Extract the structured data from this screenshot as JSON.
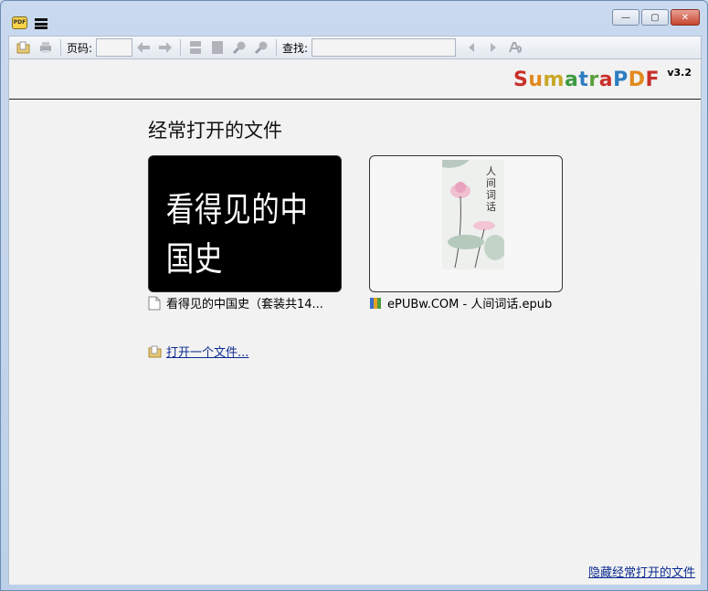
{
  "window": {
    "app_icon_text": "PDF",
    "buttons": {
      "minimize": "—",
      "maximize": "▢",
      "close": "✕"
    }
  },
  "toolbar": {
    "page_label": "页码:",
    "page_value": "",
    "find_label": "查找:",
    "find_value": ""
  },
  "brand": {
    "logo_letters": [
      {
        "ch": "S",
        "color": "#c8312b"
      },
      {
        "ch": "u",
        "color": "#e28a1e"
      },
      {
        "ch": "m",
        "color": "#c9a826"
      },
      {
        "ch": "a",
        "color": "#3d9a3f"
      },
      {
        "ch": "t",
        "color": "#2d7dc0"
      },
      {
        "ch": "r",
        "color": "#5a9e3a"
      },
      {
        "ch": "a",
        "color": "#c8312b"
      },
      {
        "ch": "P",
        "color": "#2d7dc0"
      },
      {
        "ch": "D",
        "color": "#e28a1e"
      },
      {
        "ch": "F",
        "color": "#c8312b"
      }
    ],
    "version": "v3.2"
  },
  "home": {
    "section_title": "经常打开的文件",
    "recent_files": [
      {
        "cover_text": "看得见的中国史",
        "label": "看得见的中国史（套装共14..."
      },
      {
        "cover_title": "人间词话",
        "label": "ePUBw.COM - 人间词话.epub"
      }
    ],
    "open_file_link": "打开一个文件...",
    "hide_recent_link": "隐藏经常打开的文件"
  }
}
